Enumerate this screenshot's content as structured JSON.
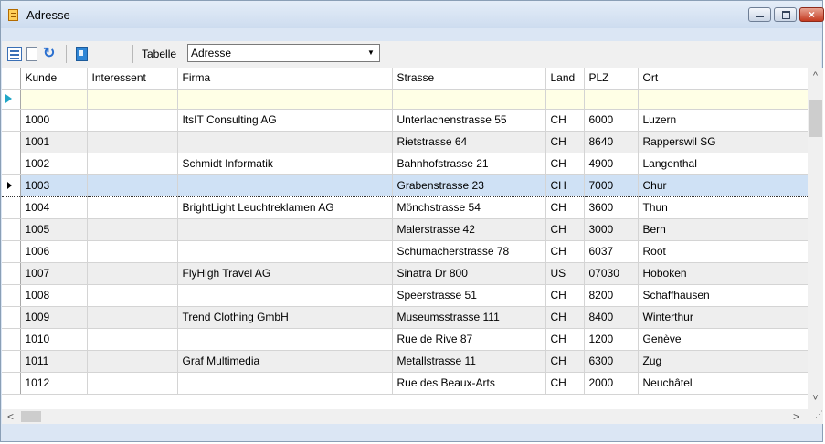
{
  "window": {
    "title": "Adresse",
    "close_glyph": "×"
  },
  "toolbar": {
    "icons": [
      "list-view-icon",
      "new-document-icon",
      "refresh-icon",
      "address-book-icon"
    ],
    "tabelle_label": "Tabelle",
    "tabelle_value": "Adresse"
  },
  "grid": {
    "columns": [
      "",
      "Kunde",
      "Interessent",
      "Firma",
      "Strasse",
      "Land",
      "PLZ",
      "Ort"
    ],
    "rows": [
      [
        "1000",
        "",
        "ItsIT Consulting AG",
        "Unterlachenstrasse 55",
        "CH",
        "6000",
        "Luzern"
      ],
      [
        "1001",
        "",
        "",
        "Rietstrasse 64",
        "CH",
        "8640",
        "Rapperswil SG"
      ],
      [
        "1002",
        "",
        "Schmidt Informatik",
        "Bahnhofstrasse 21",
        "CH",
        "4900",
        "Langenthal"
      ],
      [
        "1003",
        "",
        "",
        "Grabenstrasse 23",
        "CH",
        "7000",
        "Chur"
      ],
      [
        "1004",
        "",
        "BrightLight Leuchtreklamen AG",
        "Mönchstrasse 54",
        "CH",
        "3600",
        "Thun"
      ],
      [
        "1005",
        "",
        "",
        "Malerstrasse 42",
        "CH",
        "3000",
        "Bern"
      ],
      [
        "1006",
        "",
        "",
        "Schumacherstrasse 78",
        "CH",
        "6037",
        "Root"
      ],
      [
        "1007",
        "",
        "FlyHigh Travel AG",
        "Sinatra Dr 800",
        "US",
        "07030",
        "Hoboken"
      ],
      [
        "1008",
        "",
        "",
        "Speerstrasse 51",
        "CH",
        "8200",
        "Schaffhausen"
      ],
      [
        "1009",
        "",
        "Trend Clothing GmbH",
        "Museumsstrasse 111",
        "CH",
        "8400",
        "Winterthur"
      ],
      [
        "1010",
        "",
        "",
        "Rue de Rive 87",
        "CH",
        "1200",
        "Genève"
      ],
      [
        "1011",
        "",
        "Graf Multimedia",
        "Metallstrasse 11",
        "CH",
        "6300",
        "Zug"
      ],
      [
        "1012",
        "",
        "",
        "Rue des Beaux-Arts",
        "CH",
        "2000",
        "Neuchâtel"
      ]
    ],
    "selected_row": 3
  },
  "scroll": {
    "up": "^",
    "down": "˅",
    "left": "<",
    "right": ">"
  },
  "colors": {
    "selection": "#cfe1f5",
    "alt_row": "#eeeeee",
    "new_row": "#ffffe6"
  }
}
